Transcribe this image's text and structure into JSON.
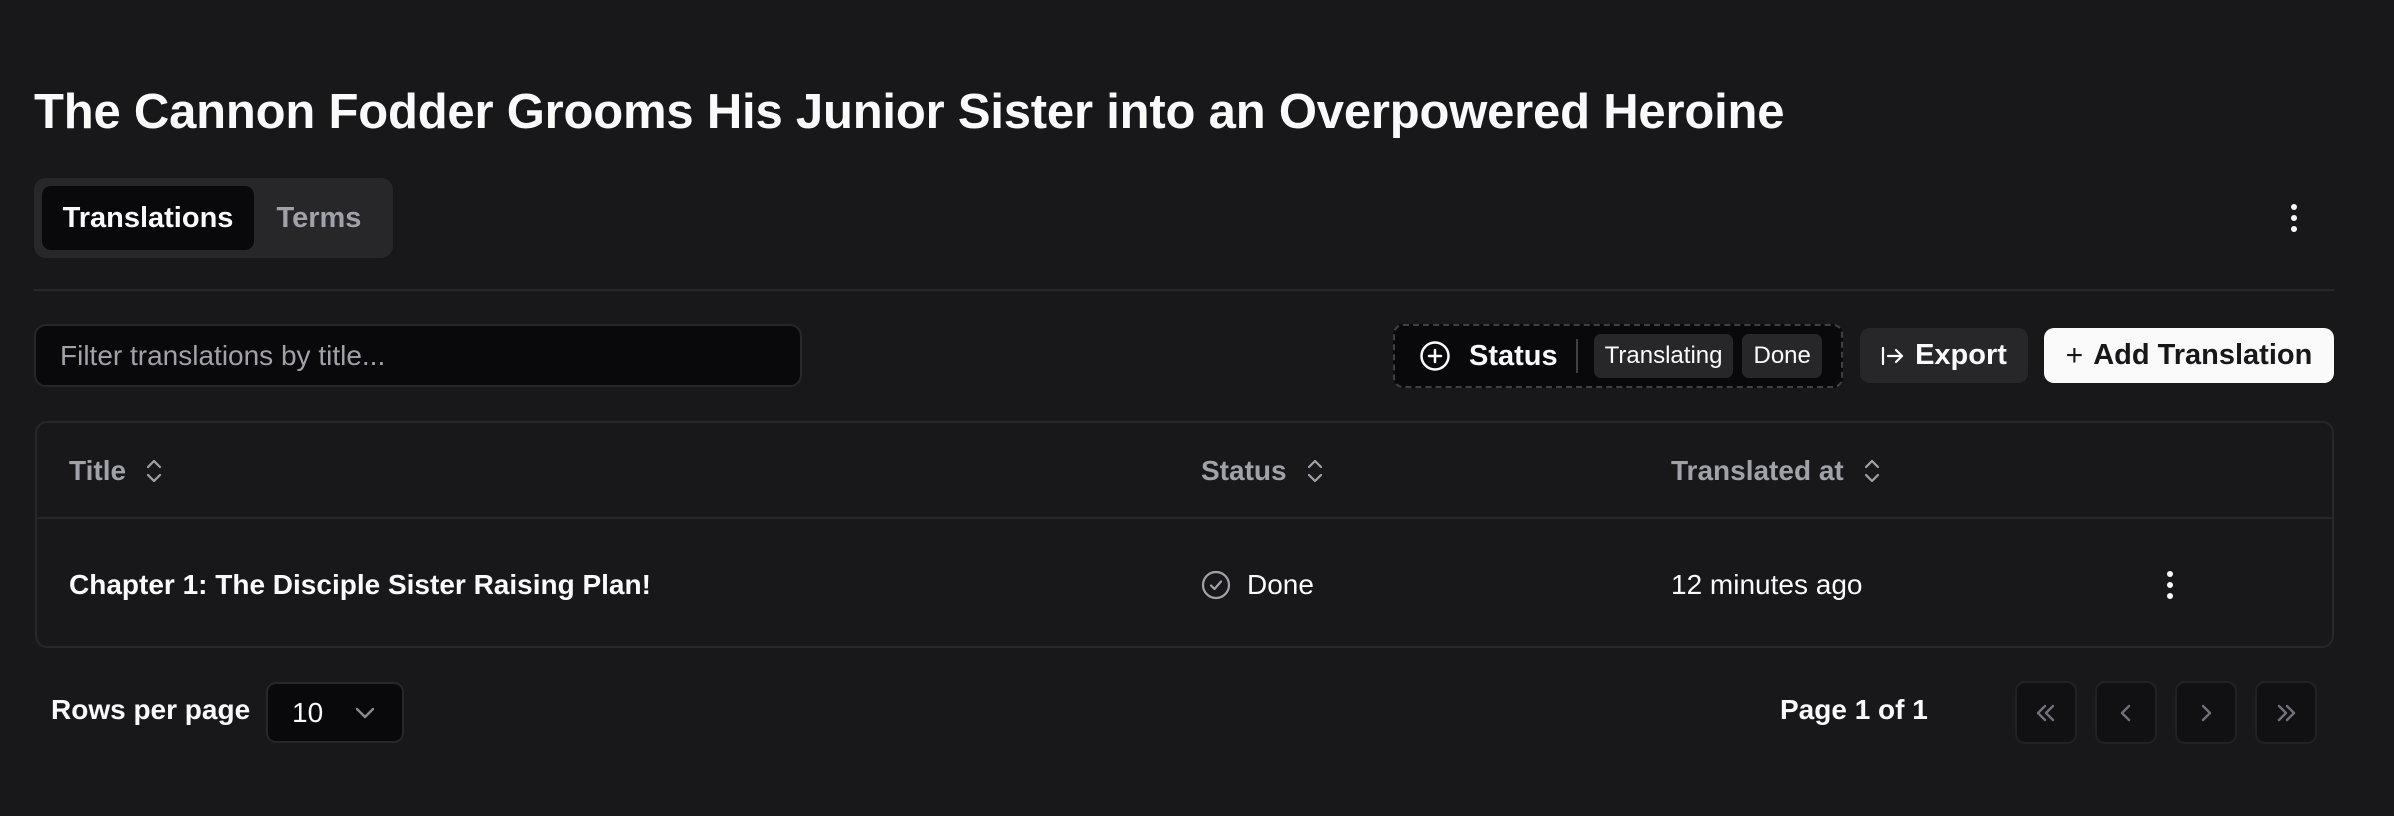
{
  "header": {
    "title": "The Cannon Fodder Grooms His Junior Sister into an Overpowered Heroine",
    "menu_icon": "more-vertical-icon"
  },
  "tabs": [
    {
      "label": "Translations",
      "active": true
    },
    {
      "label": "Terms",
      "active": false
    }
  ],
  "toolbar": {
    "filter_placeholder": "Filter translations by title...",
    "filter_value": "",
    "status_filter": {
      "label": "Status",
      "icon": "plus-circle-icon",
      "selected": [
        "Translating",
        "Done"
      ]
    },
    "export_label": "Export",
    "export_icon": "arrow-right-to-line-icon",
    "add_label": "Add Translation",
    "add_icon": "plus-icon"
  },
  "table": {
    "columns": [
      {
        "label": "Title",
        "sortable": true
      },
      {
        "label": "Status",
        "sortable": true
      },
      {
        "label": "Translated at",
        "sortable": true
      }
    ],
    "rows": [
      {
        "title": "Chapter 1: The Disciple Sister Raising Plan!",
        "status": "Done",
        "status_icon": "check-circle-icon",
        "translated_at": "12 minutes ago"
      }
    ]
  },
  "pagination": {
    "rows_per_page_label": "Rows per page",
    "rows_per_page_value": "10",
    "page_info": "Page 1 of 1",
    "buttons": [
      "first-page",
      "previous-page",
      "next-page",
      "last-page"
    ]
  },
  "colors": {
    "background": "#18181b",
    "surface": "#27272a",
    "input": "#09090b",
    "text": "#fafafa",
    "muted_text": "#a1a1aa",
    "primary_button": "#fafafa"
  }
}
